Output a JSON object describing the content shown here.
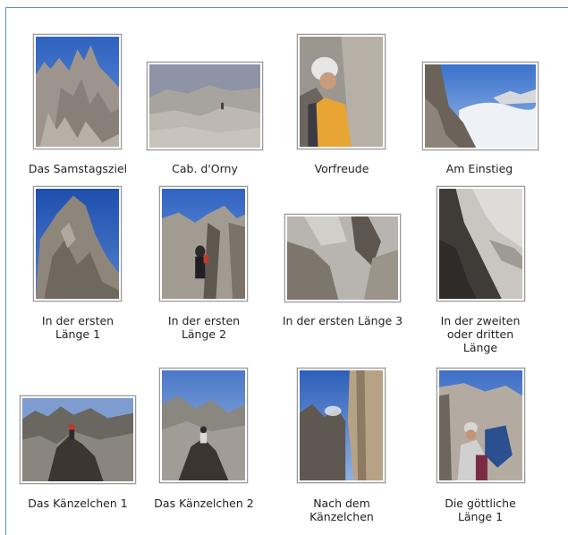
{
  "gallery": {
    "items": [
      {
        "caption_lines": [
          "Das Samstagsziel"
        ]
      },
      {
        "caption_lines": [
          "Cab. d'Orny"
        ]
      },
      {
        "caption_lines": [
          "Vorfreude"
        ]
      },
      {
        "caption_lines": [
          "Am Einstieg"
        ]
      },
      {
        "caption_lines": [
          "In der ersten",
          "Länge 1"
        ]
      },
      {
        "caption_lines": [
          "In der ersten",
          "Länge 2"
        ]
      },
      {
        "caption_lines": [
          "In der ersten Länge 3"
        ]
      },
      {
        "caption_lines": [
          "In der zweiten",
          "oder dritten",
          "Länge"
        ]
      },
      {
        "caption_lines": [
          "Das Känzelchen 1"
        ]
      },
      {
        "caption_lines": [
          "Das Känzelchen 2"
        ]
      },
      {
        "caption_lines": [
          "Nach dem",
          "Känzelchen"
        ]
      },
      {
        "caption_lines": [
          "Die göttliche",
          "Länge 1"
        ]
      }
    ]
  },
  "colors": {
    "frame_border": "#5a8fc8",
    "sky": "#3d6fc4",
    "rock": "#a9a39a",
    "caption_text": "#222222"
  }
}
